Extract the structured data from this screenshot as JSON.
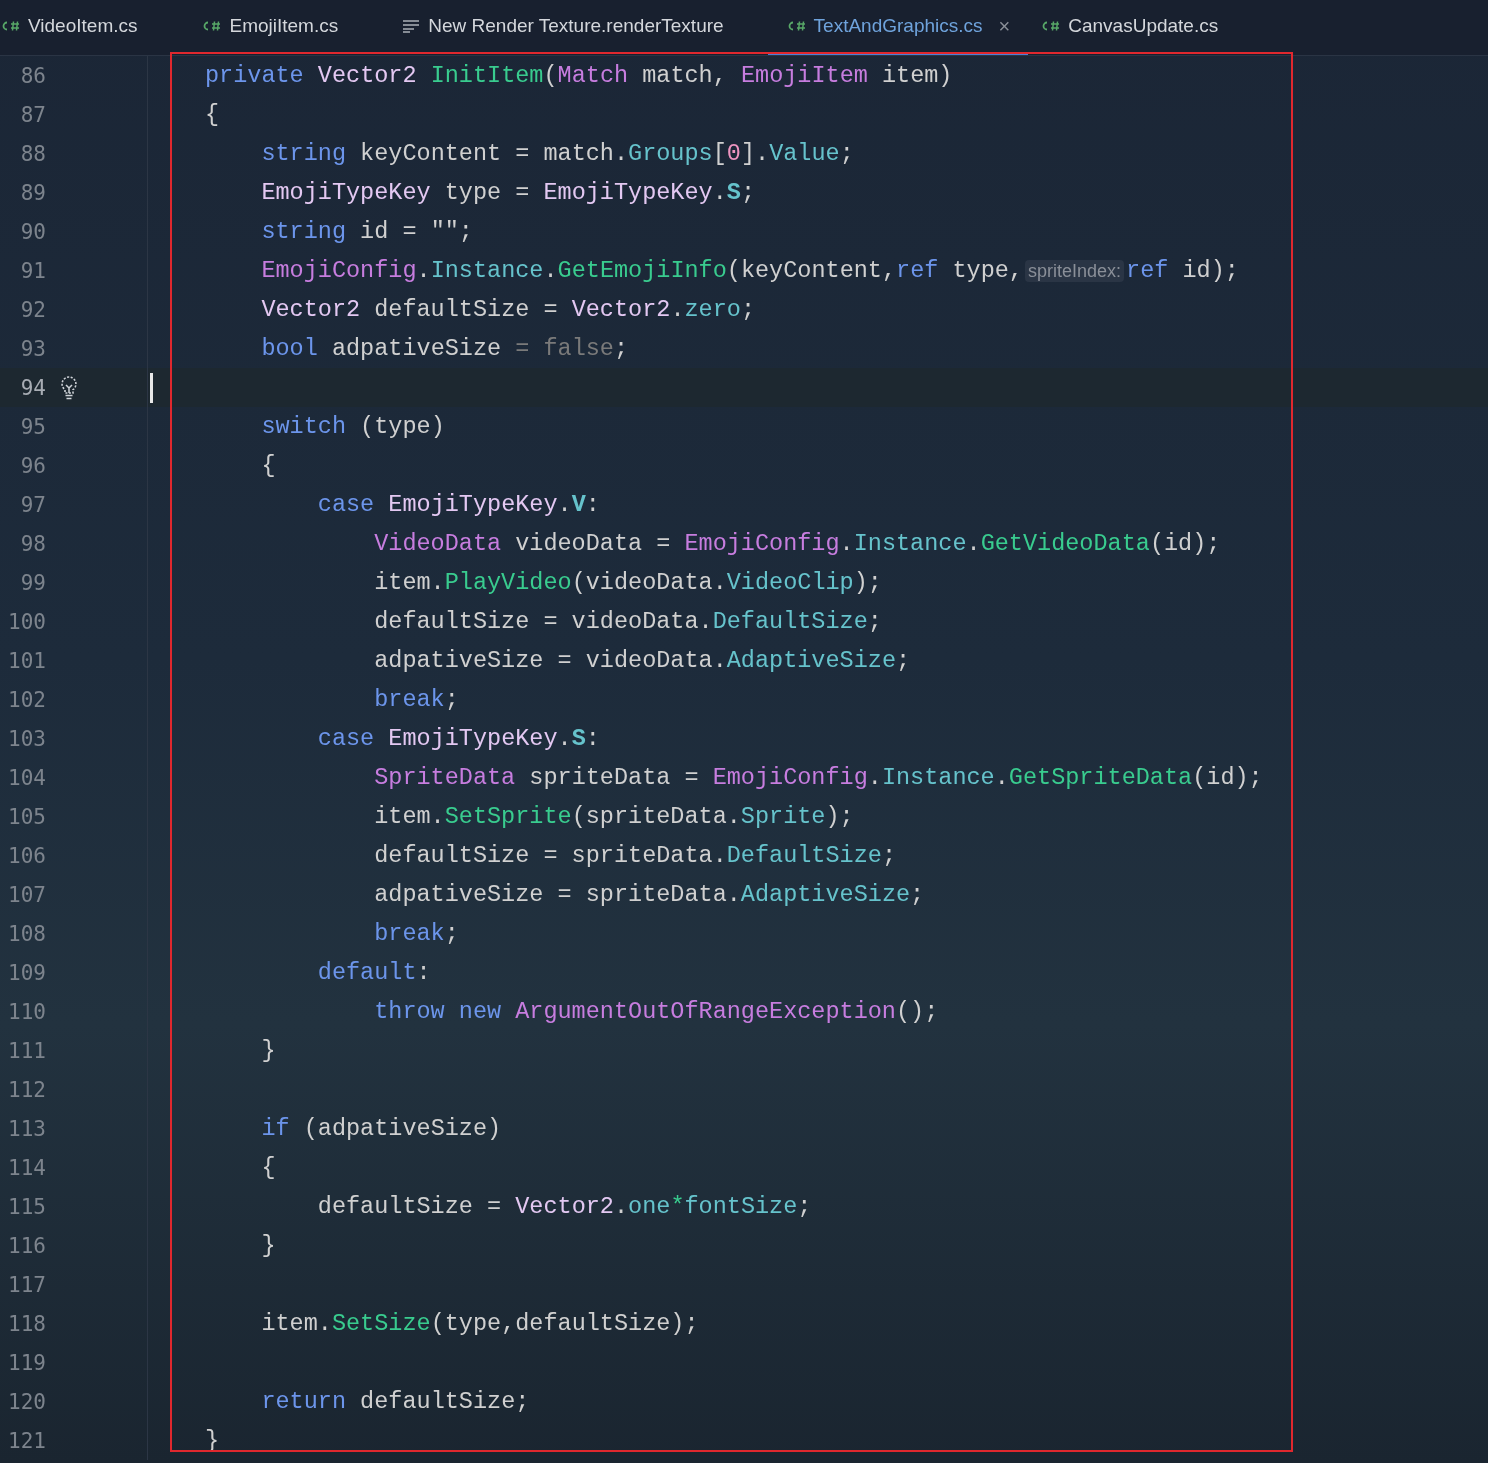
{
  "tabs": [
    {
      "label": "VideoItem.cs",
      "kind": "csharp",
      "selected": false
    },
    {
      "label": "EmojiItem.cs",
      "kind": "csharp",
      "selected": false
    },
    {
      "label": "New Render Texture.renderTexture",
      "kind": "text",
      "selected": false
    },
    {
      "label": "TextAndGraphics.cs",
      "kind": "csharp",
      "selected": true,
      "close": "×"
    },
    {
      "label": "CanvasUpdate.cs",
      "kind": "csharp",
      "selected": false
    }
  ],
  "lines": [
    {
      "number": "86",
      "current": false,
      "tokens": [
        {
          "kind": "kw",
          "t": "private "
        },
        {
          "kind": "struct",
          "t": "Vector2 "
        },
        {
          "kind": "method",
          "t": "InitItem"
        },
        {
          "kind": "p",
          "t": "("
        },
        {
          "kind": "class",
          "t": "Match"
        },
        {
          "kind": "p",
          "t": " match, "
        },
        {
          "kind": "class",
          "t": "EmojiItem"
        },
        {
          "kind": "p",
          "t": " item)"
        }
      ]
    },
    {
      "number": "87",
      "current": false,
      "tokens": [
        {
          "kind": "p",
          "t": "{"
        }
      ]
    },
    {
      "number": "88",
      "current": false,
      "tokens": [
        {
          "kind": "kw",
          "t": "    string"
        },
        {
          "kind": "p",
          "t": " keyContent = match."
        },
        {
          "kind": "field",
          "t": "Groups"
        },
        {
          "kind": "p",
          "t": "["
        },
        {
          "kind": "num",
          "t": "0"
        },
        {
          "kind": "p",
          "t": "]."
        },
        {
          "kind": "field",
          "t": "Value"
        },
        {
          "kind": "p",
          "t": ";"
        }
      ]
    },
    {
      "number": "89",
      "current": false,
      "tokens": [
        {
          "kind": "enum",
          "t": "    EmojiTypeKey"
        },
        {
          "kind": "p",
          "t": " type = "
        },
        {
          "kind": "enum",
          "t": "EmojiTypeKey"
        },
        {
          "kind": "p",
          "t": "."
        },
        {
          "kind": "member",
          "t": "S"
        },
        {
          "kind": "p",
          "t": ";"
        }
      ]
    },
    {
      "number": "90",
      "current": false,
      "tokens": [
        {
          "kind": "kw",
          "t": "    string"
        },
        {
          "kind": "p",
          "t": " id = \"\";"
        }
      ]
    },
    {
      "number": "91",
      "current": false,
      "tokens": [
        {
          "kind": "class",
          "t": "    EmojiConfig"
        },
        {
          "kind": "p",
          "t": "."
        },
        {
          "kind": "field",
          "t": "Instance"
        },
        {
          "kind": "p",
          "t": "."
        },
        {
          "kind": "method",
          "t": "GetEmojiInfo"
        },
        {
          "kind": "p",
          "t": "(keyContent,"
        },
        {
          "kind": "kw",
          "t": "ref"
        },
        {
          "kind": "p",
          "t": " type,"
        },
        {
          "kind": "hint",
          "t": "spriteIndex:"
        },
        {
          "kind": "kw",
          "t": "ref"
        },
        {
          "kind": "p",
          "t": " id);"
        }
      ]
    },
    {
      "number": "92",
      "current": false,
      "tokens": [
        {
          "kind": "struct",
          "t": "    Vector2"
        },
        {
          "kind": "p",
          "t": " defaultSize = "
        },
        {
          "kind": "struct",
          "t": "Vector2"
        },
        {
          "kind": "p",
          "t": "."
        },
        {
          "kind": "field",
          "t": "zero"
        },
        {
          "kind": "p",
          "t": ";"
        }
      ]
    },
    {
      "number": "93",
      "current": false,
      "tokens": [
        {
          "kind": "kw",
          "t": "    bool"
        },
        {
          "kind": "p",
          "t": " adpativeSize "
        },
        {
          "kind": "dim",
          "t": "= false"
        },
        {
          "kind": "p",
          "t": ";"
        }
      ]
    },
    {
      "number": "94",
      "current": true
    },
    {
      "number": "95",
      "current": false,
      "tokens": [
        {
          "kind": "kw",
          "t": "    switch"
        },
        {
          "kind": "p",
          "t": " (type)"
        }
      ]
    },
    {
      "number": "96",
      "current": false,
      "tokens": [
        {
          "kind": "p",
          "t": "    {"
        }
      ]
    },
    {
      "number": "97",
      "current": false,
      "tokens": [
        {
          "kind": "kw",
          "t": "        case"
        },
        {
          "kind": "enum",
          "t": " EmojiTypeKey"
        },
        {
          "kind": "p",
          "t": "."
        },
        {
          "kind": "member",
          "t": "V"
        },
        {
          "kind": "p",
          "t": ":"
        }
      ]
    },
    {
      "number": "98",
      "current": false,
      "tokens": [
        {
          "kind": "class",
          "t": "            VideoData"
        },
        {
          "kind": "p",
          "t": " videoData = "
        },
        {
          "kind": "class",
          "t": "EmojiConfig"
        },
        {
          "kind": "p",
          "t": "."
        },
        {
          "kind": "field",
          "t": "Instance"
        },
        {
          "kind": "p",
          "t": "."
        },
        {
          "kind": "method",
          "t": "GetVideoData"
        },
        {
          "kind": "p",
          "t": "(id);"
        }
      ]
    },
    {
      "number": "99",
      "current": false,
      "tokens": [
        {
          "kind": "p",
          "t": "            item."
        },
        {
          "kind": "method",
          "t": "PlayVideo"
        },
        {
          "kind": "p",
          "t": "(videoData."
        },
        {
          "kind": "field",
          "t": "VideoClip"
        },
        {
          "kind": "p",
          "t": ");"
        }
      ]
    },
    {
      "number": "100",
      "current": false,
      "tokens": [
        {
          "kind": "p",
          "t": "            defaultSize = videoData."
        },
        {
          "kind": "field",
          "t": "DefaultSize"
        },
        {
          "kind": "p",
          "t": ";"
        }
      ]
    },
    {
      "number": "101",
      "current": false,
      "tokens": [
        {
          "kind": "p",
          "t": "            adpativeSize = videoData."
        },
        {
          "kind": "field",
          "t": "AdaptiveSize"
        },
        {
          "kind": "p",
          "t": ";"
        }
      ]
    },
    {
      "number": "102",
      "current": false,
      "tokens": [
        {
          "kind": "kw",
          "t": "            break"
        },
        {
          "kind": "p",
          "t": ";"
        }
      ]
    },
    {
      "number": "103",
      "current": false,
      "tokens": [
        {
          "kind": "kw",
          "t": "        case"
        },
        {
          "kind": "enum",
          "t": " EmojiTypeKey"
        },
        {
          "kind": "p",
          "t": "."
        },
        {
          "kind": "member",
          "t": "S"
        },
        {
          "kind": "p",
          "t": ":"
        }
      ]
    },
    {
      "number": "104",
      "current": false,
      "tokens": [
        {
          "kind": "class",
          "t": "            SpriteData"
        },
        {
          "kind": "p",
          "t": " spriteData = "
        },
        {
          "kind": "class",
          "t": "EmojiConfig"
        },
        {
          "kind": "p",
          "t": "."
        },
        {
          "kind": "field",
          "t": "Instance"
        },
        {
          "kind": "p",
          "t": "."
        },
        {
          "kind": "method",
          "t": "GetSpriteData"
        },
        {
          "kind": "p",
          "t": "(id);"
        }
      ]
    },
    {
      "number": "105",
      "current": false,
      "tokens": [
        {
          "kind": "p",
          "t": "            item."
        },
        {
          "kind": "method",
          "t": "SetSprite"
        },
        {
          "kind": "p",
          "t": "(spriteData."
        },
        {
          "kind": "field",
          "t": "Sprite"
        },
        {
          "kind": "p",
          "t": ");"
        }
      ]
    },
    {
      "number": "106",
      "current": false,
      "tokens": [
        {
          "kind": "p",
          "t": "            defaultSize = spriteData."
        },
        {
          "kind": "field",
          "t": "DefaultSize"
        },
        {
          "kind": "p",
          "t": ";"
        }
      ]
    },
    {
      "number": "107",
      "current": false,
      "tokens": [
        {
          "kind": "p",
          "t": "            adpativeSize = spriteData."
        },
        {
          "kind": "field",
          "t": "AdaptiveSize"
        },
        {
          "kind": "p",
          "t": ";"
        }
      ]
    },
    {
      "number": "108",
      "current": false,
      "tokens": [
        {
          "kind": "kw",
          "t": "            break"
        },
        {
          "kind": "p",
          "t": ";"
        }
      ]
    },
    {
      "number": "109",
      "current": false,
      "tokens": [
        {
          "kind": "kw",
          "t": "        default"
        },
        {
          "kind": "p",
          "t": ":"
        }
      ]
    },
    {
      "number": "110",
      "current": false,
      "tokens": [
        {
          "kind": "kw",
          "t": "            throw new"
        },
        {
          "kind": "class",
          "t": " ArgumentOutOfRangeException"
        },
        {
          "kind": "p",
          "t": "();"
        }
      ]
    },
    {
      "number": "111",
      "current": false,
      "tokens": [
        {
          "kind": "p",
          "t": "    }"
        }
      ]
    },
    {
      "number": "112",
      "current": false
    },
    {
      "number": "113",
      "current": false,
      "tokens": [
        {
          "kind": "kw",
          "t": "    if"
        },
        {
          "kind": "p",
          "t": " (adpativeSize)"
        }
      ]
    },
    {
      "number": "114",
      "current": false,
      "tokens": [
        {
          "kind": "p",
          "t": "    {"
        }
      ]
    },
    {
      "number": "115",
      "current": false,
      "tokens": [
        {
          "kind": "p",
          "t": "        defaultSize = "
        },
        {
          "kind": "struct",
          "t": "Vector2"
        },
        {
          "kind": "p",
          "t": "."
        },
        {
          "kind": "field",
          "t": "one"
        },
        {
          "kind": "op",
          "t": "*"
        },
        {
          "kind": "field",
          "t": "fontSize"
        },
        {
          "kind": "p",
          "t": ";"
        }
      ]
    },
    {
      "number": "116",
      "current": false,
      "tokens": [
        {
          "kind": "p",
          "t": "    }"
        }
      ]
    },
    {
      "number": "117",
      "current": false
    },
    {
      "number": "118",
      "current": false,
      "tokens": [
        {
          "kind": "p",
          "t": "    item."
        },
        {
          "kind": "method",
          "t": "SetSize"
        },
        {
          "kind": "p",
          "t": "(type,defaultSize);"
        }
      ]
    },
    {
      "number": "119",
      "current": false
    },
    {
      "number": "120",
      "current": false,
      "tokens": [
        {
          "kind": "kw",
          "t": "    return"
        },
        {
          "kind": "p",
          "t": " defaultSize;"
        }
      ]
    },
    {
      "number": "121",
      "current": false,
      "tokens": [
        {
          "kind": "p",
          "t": "}"
        }
      ]
    }
  ]
}
